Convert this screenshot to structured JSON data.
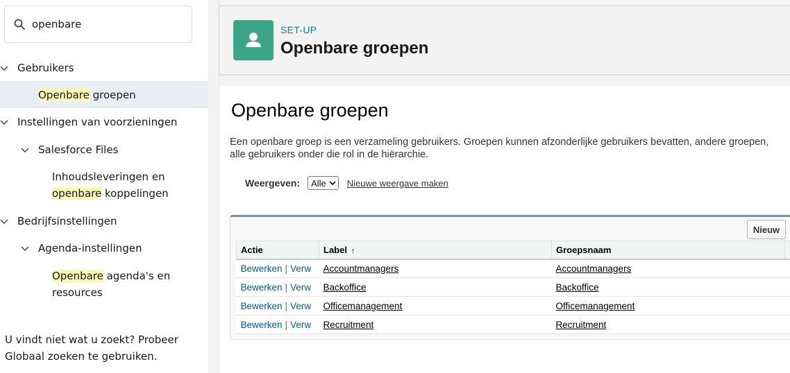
{
  "search": {
    "value": "openbare"
  },
  "tree": {
    "gebruikers": "Gebruikers",
    "openbare_groepen_hl": "Openbare",
    "openbare_groepen_rest": " groepen",
    "instellingen": "Instellingen van voorzieningen",
    "salesforce_files": "Salesforce Files",
    "inhouds_line1": "Inhoudsleveringen en",
    "inhouds_hl": "openbare",
    "inhouds_rest": " koppelingen",
    "bedrijfsinstellingen": "Bedrijfsinstellingen",
    "agenda_instellingen": "Agenda-instellingen",
    "agenda_hl": "Openbare",
    "agenda_rest": " agenda's en",
    "agenda_line2": "resources"
  },
  "help": {
    "text": "U vindt niet wat u zoekt? Probeer Globaal zoeken te gebruiken."
  },
  "header": {
    "eyebrow": "SET-UP",
    "title": "Openbare groepen",
    "icon": "user-icon",
    "icon_color": "#3ba687"
  },
  "main": {
    "title": "Openbare groepen",
    "desc_line1": "Een openbare groep is een verzameling gebruikers. Groepen kunnen afzonderlijke gebruikers bevatten, andere groepen,",
    "desc_line2": "alle gebruikers onder die rol in de hiërarchie.",
    "view_label": "Weergeven:",
    "view_value": "Alle",
    "view_link": "Nieuwe weergave maken",
    "new_button": "Nieuw"
  },
  "table": {
    "headers": {
      "actie": "Actie",
      "label": "Label",
      "groepsnaam": "Groepsnaam"
    },
    "action_edit": "Bewerken",
    "action_sep": "|",
    "action_delete": "Verw",
    "rows": [
      {
        "label": "Accountmanagers",
        "groepsnaam": "Accountmanagers"
      },
      {
        "label": "Backoffice",
        "groepsnaam": "Backoffice"
      },
      {
        "label": "Officemanagement",
        "groepsnaam": "Officemanagement"
      },
      {
        "label": "Recruitment",
        "groepsnaam": "Recruitment"
      }
    ]
  }
}
